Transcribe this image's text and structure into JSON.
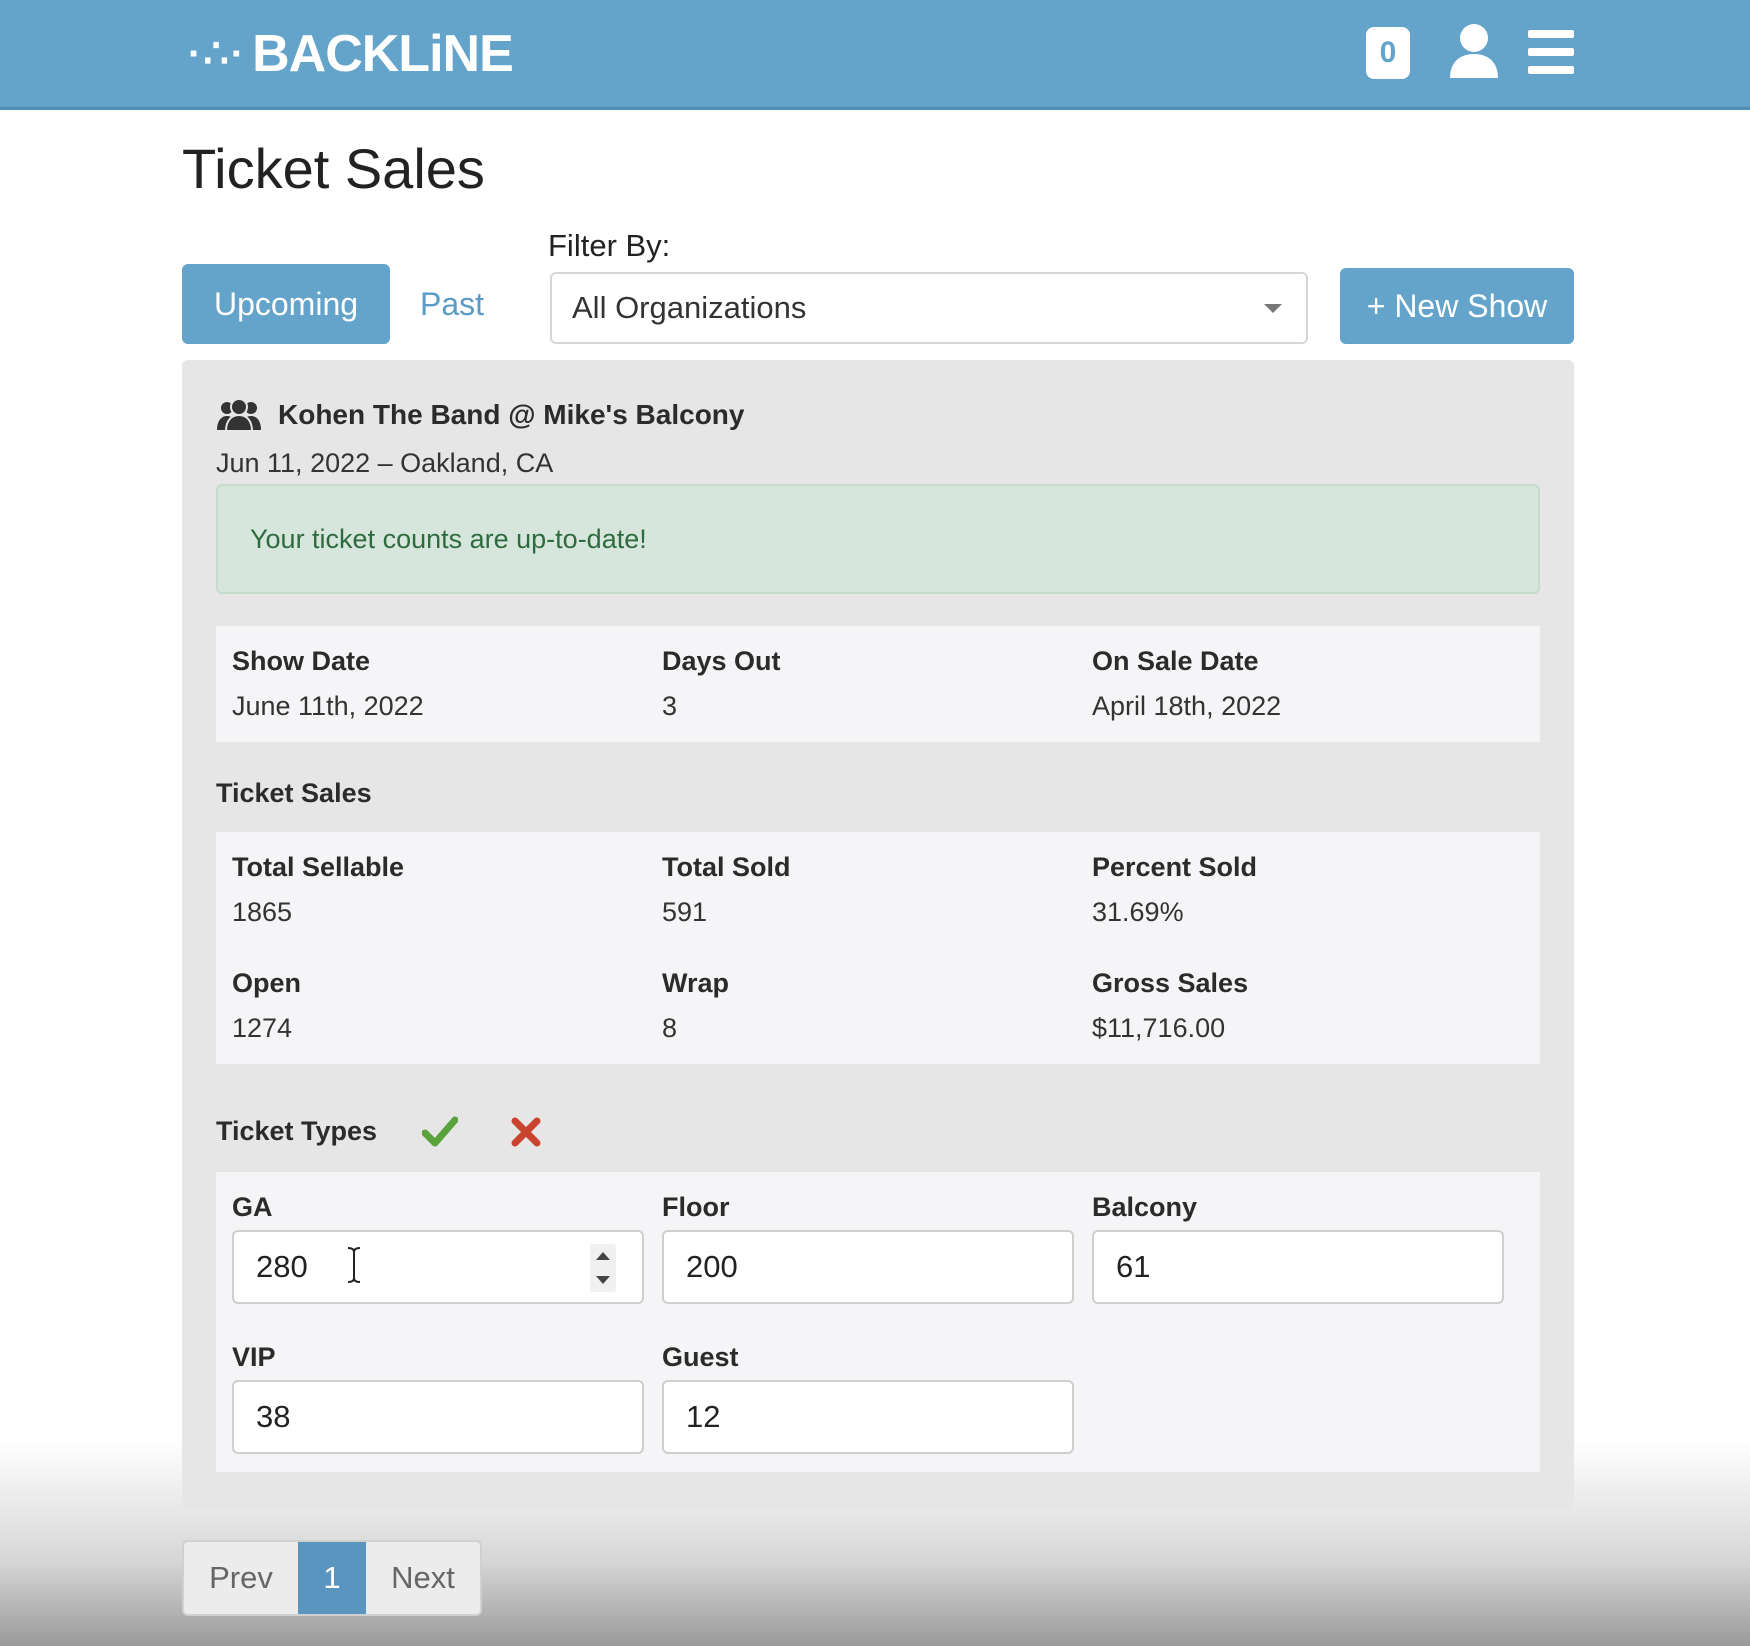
{
  "header": {
    "brand": "BACKLiNE",
    "brand_mark": "·∴·",
    "notification_count": "0",
    "user_icon": "user-icon",
    "menu_icon": "hamburger-menu-icon",
    "bar_color": "#64a4cb"
  },
  "page": {
    "title": "Ticket Sales"
  },
  "controls": {
    "tabs": [
      {
        "label": "Upcoming",
        "active": true
      },
      {
        "label": "Past",
        "active": false
      }
    ],
    "filter_label": "Filter By:",
    "filter_value": "All Organizations",
    "new_show_label": "+ New Show"
  },
  "event": {
    "title": "Kohen The Band @ Mike's Balcony",
    "subtitle": "Jun 11, 2022 – Oakland, CA",
    "status_message": "Your ticket counts are up-to-date!",
    "dates": [
      {
        "label": "Show Date",
        "value": "June 11th, 2022"
      },
      {
        "label": "Days Out",
        "value": "3"
      },
      {
        "label": "On Sale Date",
        "value": "April 18th, 2022"
      }
    ],
    "sales_heading": "Ticket Sales",
    "sales": [
      {
        "label": "Total Sellable",
        "value": "1865"
      },
      {
        "label": "Total Sold",
        "value": "591"
      },
      {
        "label": "Percent Sold",
        "value": "31.69%"
      },
      {
        "label": "Open",
        "value": "1274"
      },
      {
        "label": "Wrap",
        "value": "8"
      },
      {
        "label": "Gross Sales",
        "value": "$11,716.00"
      }
    ],
    "types_heading": "Ticket Types",
    "types": [
      {
        "label": "GA",
        "value": "280"
      },
      {
        "label": "Floor",
        "value": "200"
      },
      {
        "label": "Balcony",
        "value": "61"
      },
      {
        "label": "VIP",
        "value": "38"
      },
      {
        "label": "Guest",
        "value": "12"
      }
    ]
  },
  "pagination": {
    "prev": "Prev",
    "current": "1",
    "next": "Next"
  },
  "colors": {
    "accent": "#64a4cb",
    "success_bg": "#d6e6dc",
    "check": "#5aa33a",
    "cross": "#c9442e"
  }
}
